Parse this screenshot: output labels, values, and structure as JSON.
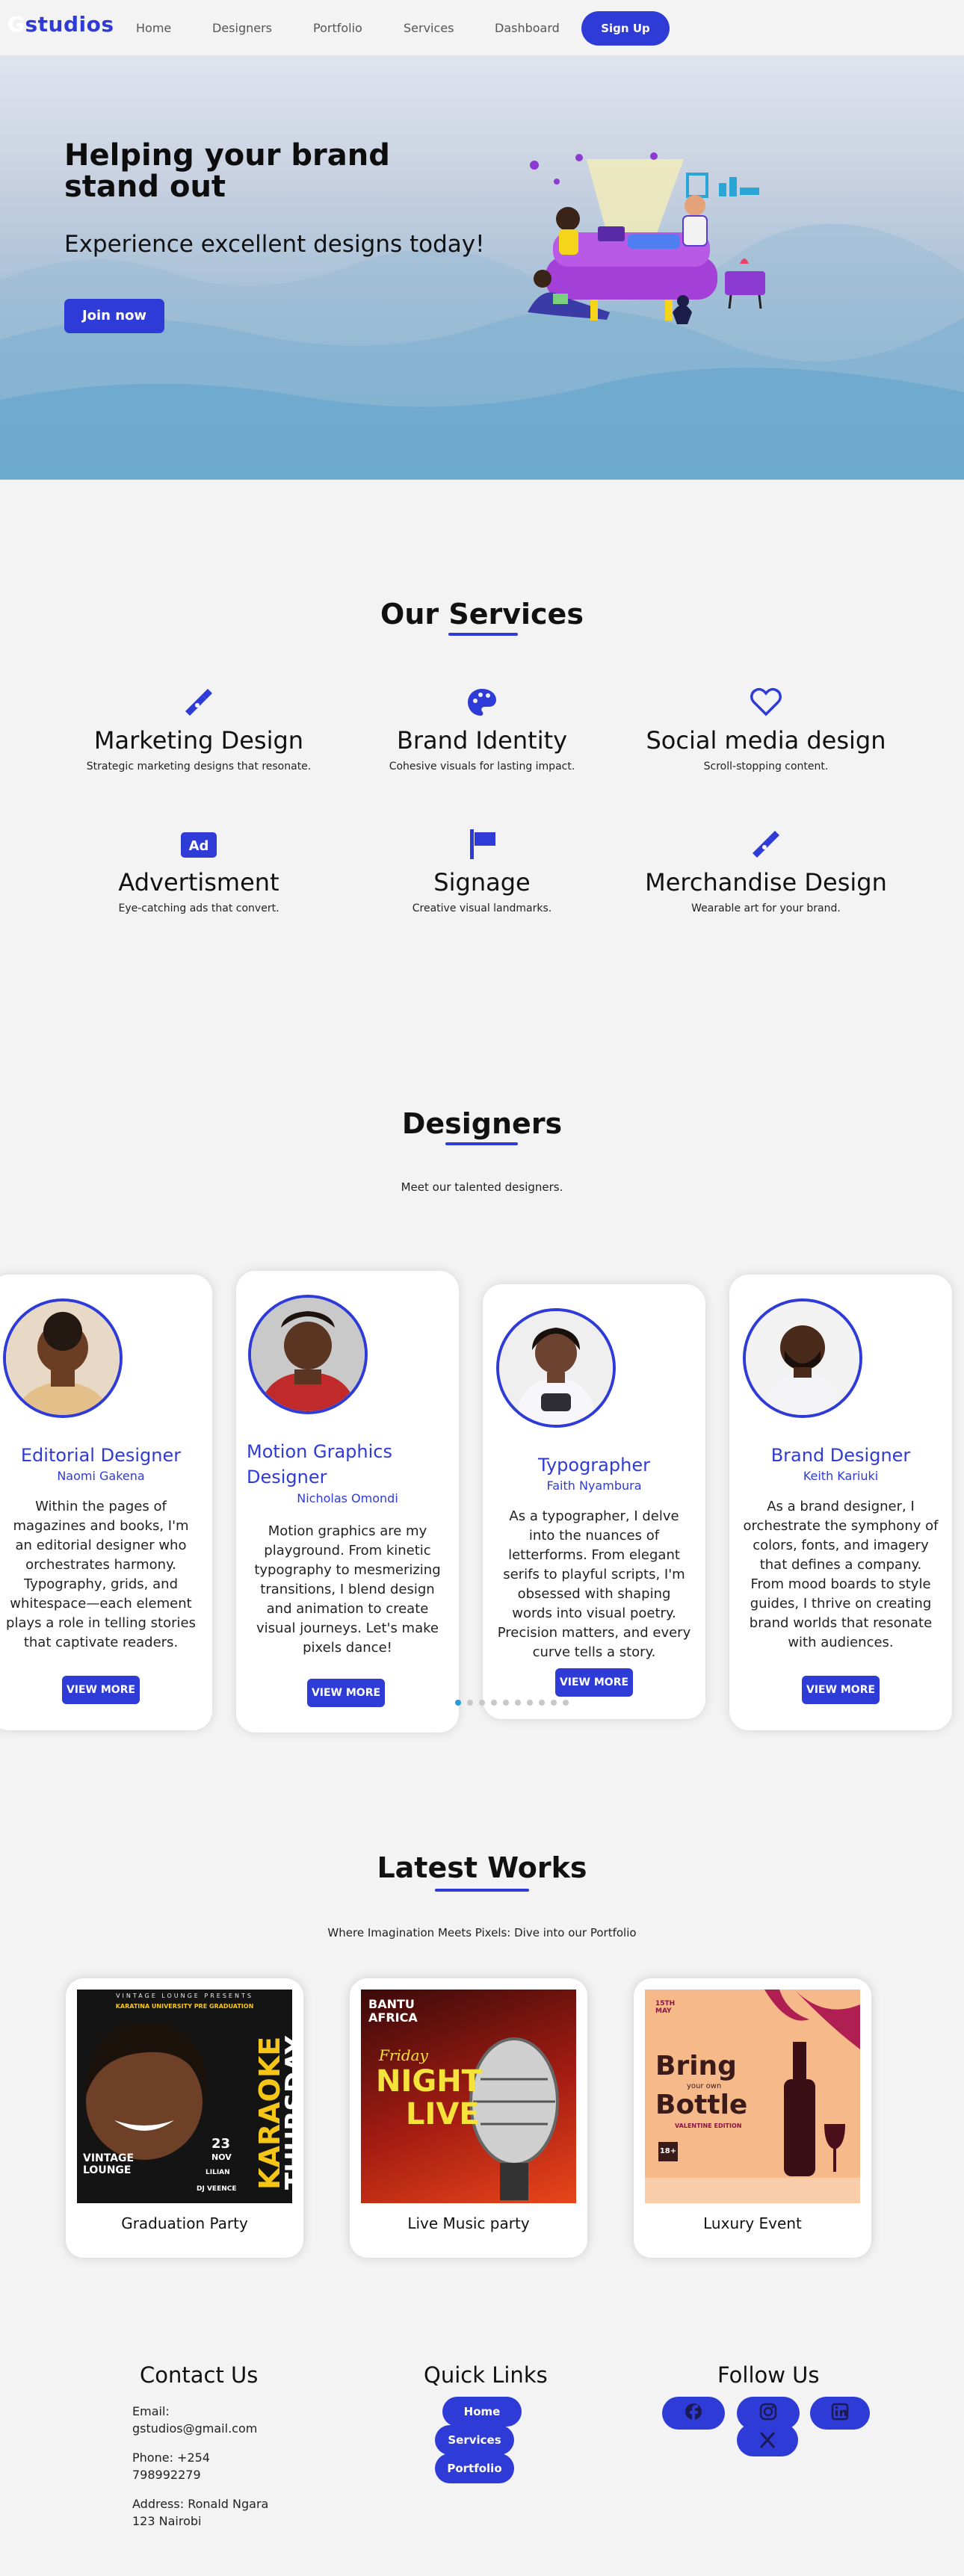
{
  "nav": {
    "logo_g": "G",
    "logo_rest": "studios",
    "links": [
      "Home",
      "Designers",
      "Portfolio",
      "Services",
      "Dashboard"
    ],
    "signup": "Sign Up"
  },
  "hero": {
    "title": "Helping your brand stand out",
    "subtitle": "Experience excellent designs today!",
    "cta": "Join now"
  },
  "services": {
    "title": "Our Services",
    "items": [
      {
        "title": "Marketing Design",
        "desc": "Strategic marketing designs that resonate.",
        "icon": "pen-nib-icon"
      },
      {
        "title": "Brand Identity",
        "desc": "Cohesive visuals for lasting impact.",
        "icon": "palette-icon"
      },
      {
        "title": "Social media design",
        "desc": "Scroll-stopping content.",
        "icon": "heart-icon"
      },
      {
        "title": "Advertisment",
        "desc": "Eye-catching ads that convert.",
        "icon": "ad-icon"
      },
      {
        "title": "Signage",
        "desc": "Creative visual landmarks.",
        "icon": "sign-icon"
      },
      {
        "title": "Merchandise Design",
        "desc": "Wearable art for your brand.",
        "icon": "pen-nib-icon"
      }
    ]
  },
  "designers": {
    "title": "Designers",
    "subtitle": "Meet our talented designers.",
    "cards": [
      {
        "role": "Editorial Designer",
        "name": "Naomi Gakena",
        "bio": "Within the pages of magazines and books, I'm an editorial designer who orchestrates harmony. Typography, grids, and whitespace—each element plays a role in telling stories that captivate readers.",
        "button": "VIEW MORE"
      },
      {
        "role": "Motion Graphics Designer",
        "name": "Nicholas Omondi",
        "bio": "Motion graphics are my playground. From kinetic typography to mesmerizing transitions, I blend design and animation to create visual journeys. Let's make pixels dance!",
        "button": "VIEW MORE"
      },
      {
        "role": "Typographer",
        "name": "Faith Nyambura",
        "bio": "As a typographer, I delve into the nuances of letterforms. From elegant serifs to playful scripts, I'm obsessed with shaping words into visual poetry. Precision matters, and every curve tells a story.",
        "button": "VIEW MORE"
      },
      {
        "role": "Brand Designer",
        "name": "Keith Kariuki",
        "bio": "As a brand designer, I orchestrate the symphony of colors, fonts, and imagery that defines a company. From mood boards to style guides, I thrive on creating brand worlds that resonate with audiences.",
        "button": "VIEW MORE"
      }
    ],
    "carousel_total": 10,
    "carousel_active": 1
  },
  "works": {
    "title": "Latest Works",
    "subtitle": "Where Imagination Meets Pixels: Dive into our Portfolio",
    "items": [
      {
        "caption": "Graduation Party",
        "poster": {
          "top": "VINTAGE LOUNGE PRESENTS",
          "sub": "KARATINA UNIVERSITY PRE GRADUATION",
          "big1": "KARAOKE",
          "big2": "THURSDAY",
          "venue": "VINTAGE LOUNGE",
          "date": "23",
          "month": "NOV",
          "guest": "LILIAN",
          "dj": "DJ VEENCE"
        }
      },
      {
        "caption": "Live Music party",
        "poster": {
          "brand1": "BANTU",
          "brand2": "AFRICA",
          "script": "Friday",
          "big1": "NIGHT",
          "big2": "LIVE"
        }
      },
      {
        "caption": "Luxury Event",
        "poster": {
          "date": "15TH MAY",
          "big1": "Bring",
          "sub": "your own",
          "big2": "Bottle",
          "tag": "VALENTINE EDITION",
          "age": "18+"
        }
      }
    ]
  },
  "footer": {
    "contact": {
      "title": "Contact Us",
      "email": "Email: gstudios@gmail.com",
      "phone": "Phone: +254 798992279",
      "address": "Address: Ronald Ngara 123 Nairobi"
    },
    "quick": {
      "title": "Quick Links",
      "links": [
        "Home",
        "Services",
        "Portfolio"
      ]
    },
    "follow": {
      "title": "Follow Us",
      "icons": [
        "facebook-icon",
        "instagram-icon",
        "linkedin-icon",
        "x-icon"
      ]
    }
  },
  "colors": {
    "accent": "#2f3bd6",
    "background": "#f3f3f3"
  }
}
